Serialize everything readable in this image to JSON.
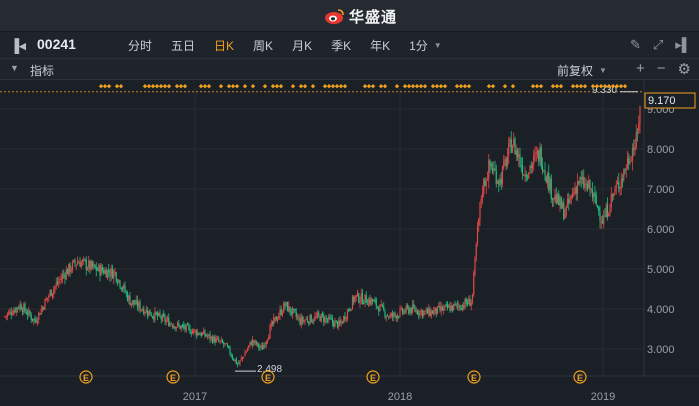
{
  "app": {
    "brand_name": "华盛通",
    "brand_color": "#e8352e"
  },
  "toolbar": {
    "symbol": "00241",
    "periods": [
      "分时",
      "五日",
      "日K",
      "周K",
      "月K",
      "季K",
      "年K"
    ],
    "active_period": "日K",
    "minute_selector": "1分",
    "icons": [
      "sidebar-toggle-icon",
      "pencil-icon",
      "fullscreen-icon",
      "sidebar-right-icon"
    ]
  },
  "indicator_bar": {
    "label": "指标",
    "adjust_mode": "前复权",
    "icons": [
      "collapse-arrow-icon",
      "add-icon",
      "remove-icon",
      "settings-icon"
    ]
  },
  "colors": {
    "up": "#e04848",
    "down": "#1fbf80",
    "accent": "#f0a020",
    "background": "#1b1f26"
  },
  "chart_data": {
    "type": "candlestick",
    "y_ticks": [
      "3.000",
      "4.000",
      "5.000",
      "6.000",
      "7.000",
      "8.000",
      "9.000"
    ],
    "ylim": [
      2.2,
      9.6
    ],
    "x_ticks": [
      "2017",
      "2018",
      "2019"
    ],
    "last_price": "9.170",
    "high_label": "9.330",
    "low_label": "2.498",
    "event_marker": "E",
    "event_count": 7,
    "grid": true,
    "series_summary": {
      "start": 3.8,
      "low": 2.498,
      "low_period": "2017 mid",
      "jump_to": 7.5,
      "jump_period": "2018 late",
      "high": 9.33,
      "last": 9.17
    }
  }
}
